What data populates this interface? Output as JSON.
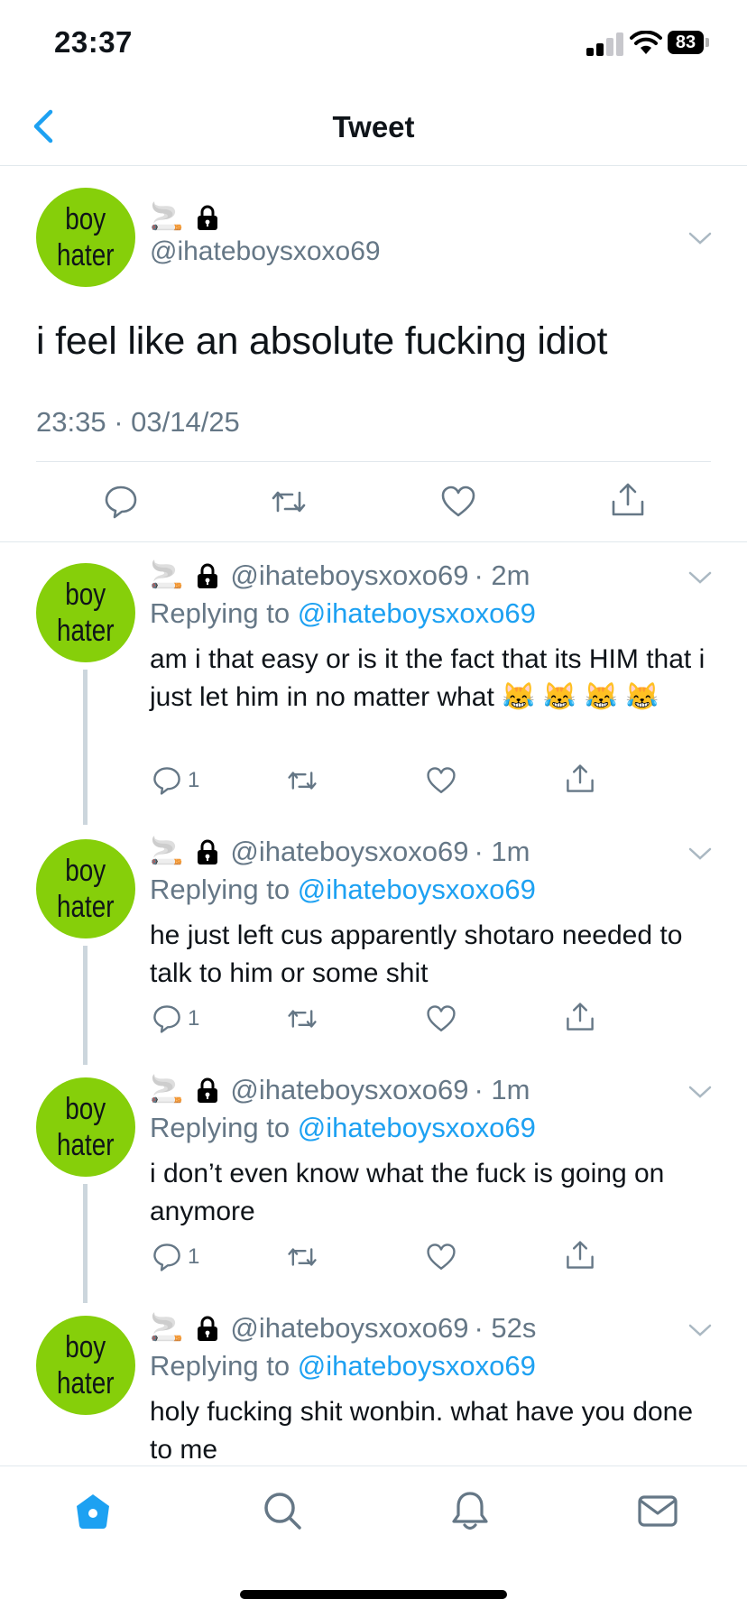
{
  "status_bar": {
    "time": "23:37",
    "battery": "83"
  },
  "header": {
    "title": "Tweet"
  },
  "main_tweet": {
    "avatar_line1": "boy",
    "avatar_line2": "hater",
    "name_emoji": "🚬",
    "handle": "@ihateboysxoxo69",
    "text": "i feel like an absolute fucking idiot",
    "timestamp": "23:35 · 03/14/25"
  },
  "replies": [
    {
      "avatar_line1": "boy",
      "avatar_line2": "hater",
      "name_emoji": "🚬",
      "handle": "@ihateboysxoxo69",
      "time": "· 2m",
      "replying_prefix": "Replying to ",
      "replying_to": "@ihateboysxoxo69",
      "text": "am i that easy or is it the fact that its HIM that i just let him in no matter what 😹 😹 😹 😹",
      "reply_count": "1"
    },
    {
      "avatar_line1": "boy",
      "avatar_line2": "hater",
      "name_emoji": "🚬",
      "handle": "@ihateboysxoxo69",
      "time": "· 1m",
      "replying_prefix": "Replying to ",
      "replying_to": "@ihateboysxoxo69",
      "text": "he just left cus apparently shotaro needed to talk to him or some shit",
      "reply_count": "1"
    },
    {
      "avatar_line1": "boy",
      "avatar_line2": "hater",
      "name_emoji": "🚬",
      "handle": "@ihateboysxoxo69",
      "time": "· 1m",
      "replying_prefix": "Replying to ",
      "replying_to": "@ihateboysxoxo69",
      "text": "i don’t even know what the fuck is going on anymore",
      "reply_count": "1"
    },
    {
      "avatar_line1": "boy",
      "avatar_line2": "hater",
      "name_emoji": "🚬",
      "handle": "@ihateboysxoxo69",
      "time": "· 52s",
      "replying_prefix": "Replying to ",
      "replying_to": "@ihateboysxoxo69",
      "text": "holy fucking shit wonbin. what have you done to me"
    }
  ],
  "colors": {
    "accent": "#1da1f2",
    "avatar_bg": "#86cf0a",
    "muted": "#657786",
    "divider": "#e1e8ed"
  },
  "tab_bar": {
    "icons": [
      "home-icon",
      "search-icon",
      "notifications-icon",
      "messages-icon"
    ]
  }
}
